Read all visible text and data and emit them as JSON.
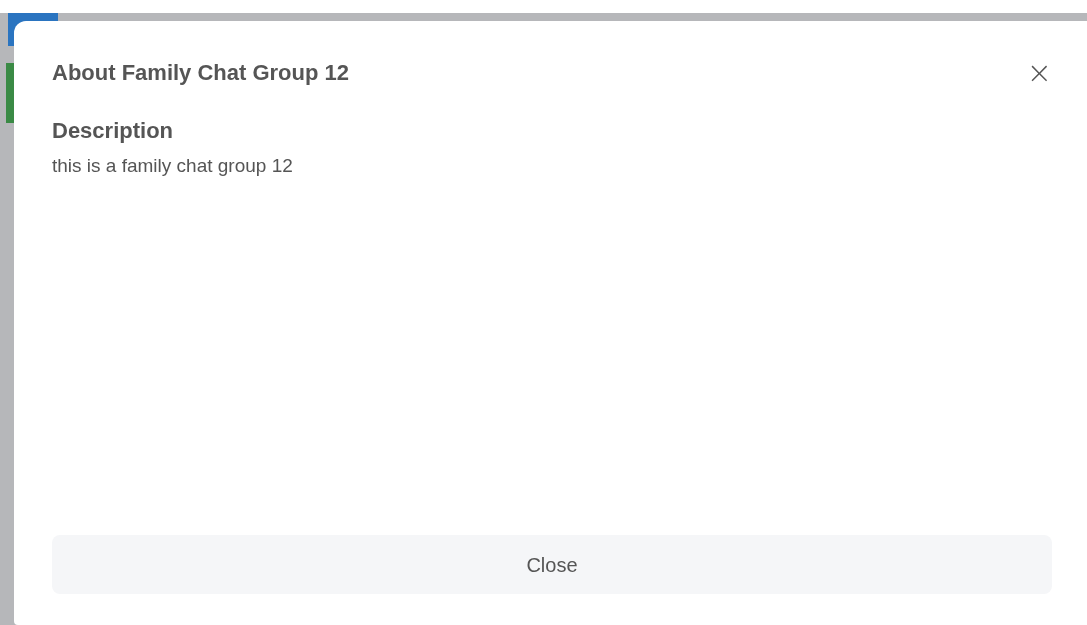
{
  "dialog": {
    "title": "About Family Chat Group 12",
    "close_icon": "×",
    "section_heading": "Description",
    "description": "this is a family chat group 12",
    "button": "Close"
  }
}
